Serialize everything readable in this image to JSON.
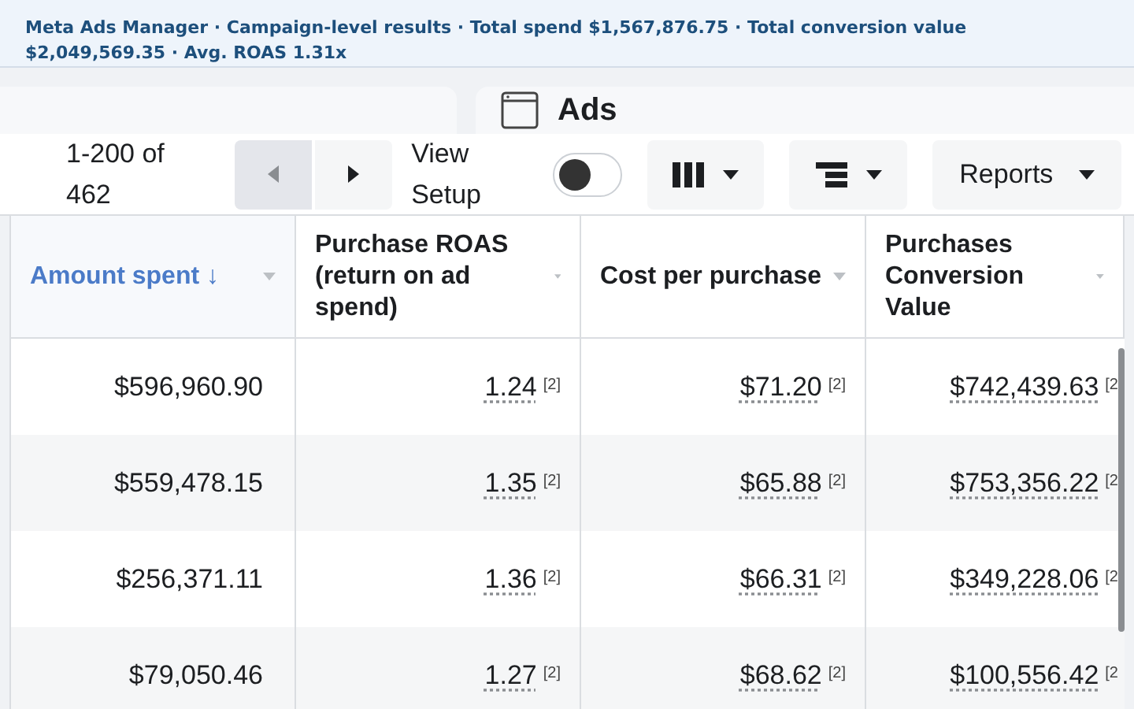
{
  "banner": {
    "text": "Meta Ads Manager · Campaign-level results · Total spend $1,567,876.75 · Total conversion value $2,049,569.35 · Avg. ROAS 1.31x"
  },
  "panel": {
    "title": "Ads"
  },
  "toolbar": {
    "range": "1-200 of 462",
    "prev_disabled": true,
    "view_setup": {
      "label": "View Setup",
      "on": false
    },
    "reports": "Reports"
  },
  "table": {
    "columns": [
      {
        "label": "Amount spent",
        "sort_arrow": "↓",
        "sorted": true
      },
      {
        "label": "Purchase ROAS (return on ad spend)",
        "sorted": false
      },
      {
        "label": "Cost per purchase",
        "sorted": false
      },
      {
        "label": "Purchases Conversion Value",
        "sorted": false
      }
    ],
    "rows": [
      {
        "amount": "$596,960.90",
        "roas": "1.24",
        "roas_note": "[2]",
        "cost": "$71.20",
        "cost_note": "[2]",
        "value": "$742,439.63",
        "value_note": "[2"
      },
      {
        "amount": "$559,478.15",
        "roas": "1.35",
        "roas_note": "[2]",
        "cost": "$65.88",
        "cost_note": "[2]",
        "value": "$753,356.22",
        "value_note": "[2"
      },
      {
        "amount": "$256,371.11",
        "roas": "1.36",
        "roas_note": "[2]",
        "cost": "$66.31",
        "cost_note": "[2]",
        "value": "$349,228.06",
        "value_note": "[2"
      },
      {
        "amount": "$79,050.46",
        "roas": "1.27",
        "roas_note": "[2]",
        "cost": "$68.62",
        "cost_note": "[2]",
        "value": "$100,556.42",
        "value_note": "[2"
      }
    ]
  }
}
